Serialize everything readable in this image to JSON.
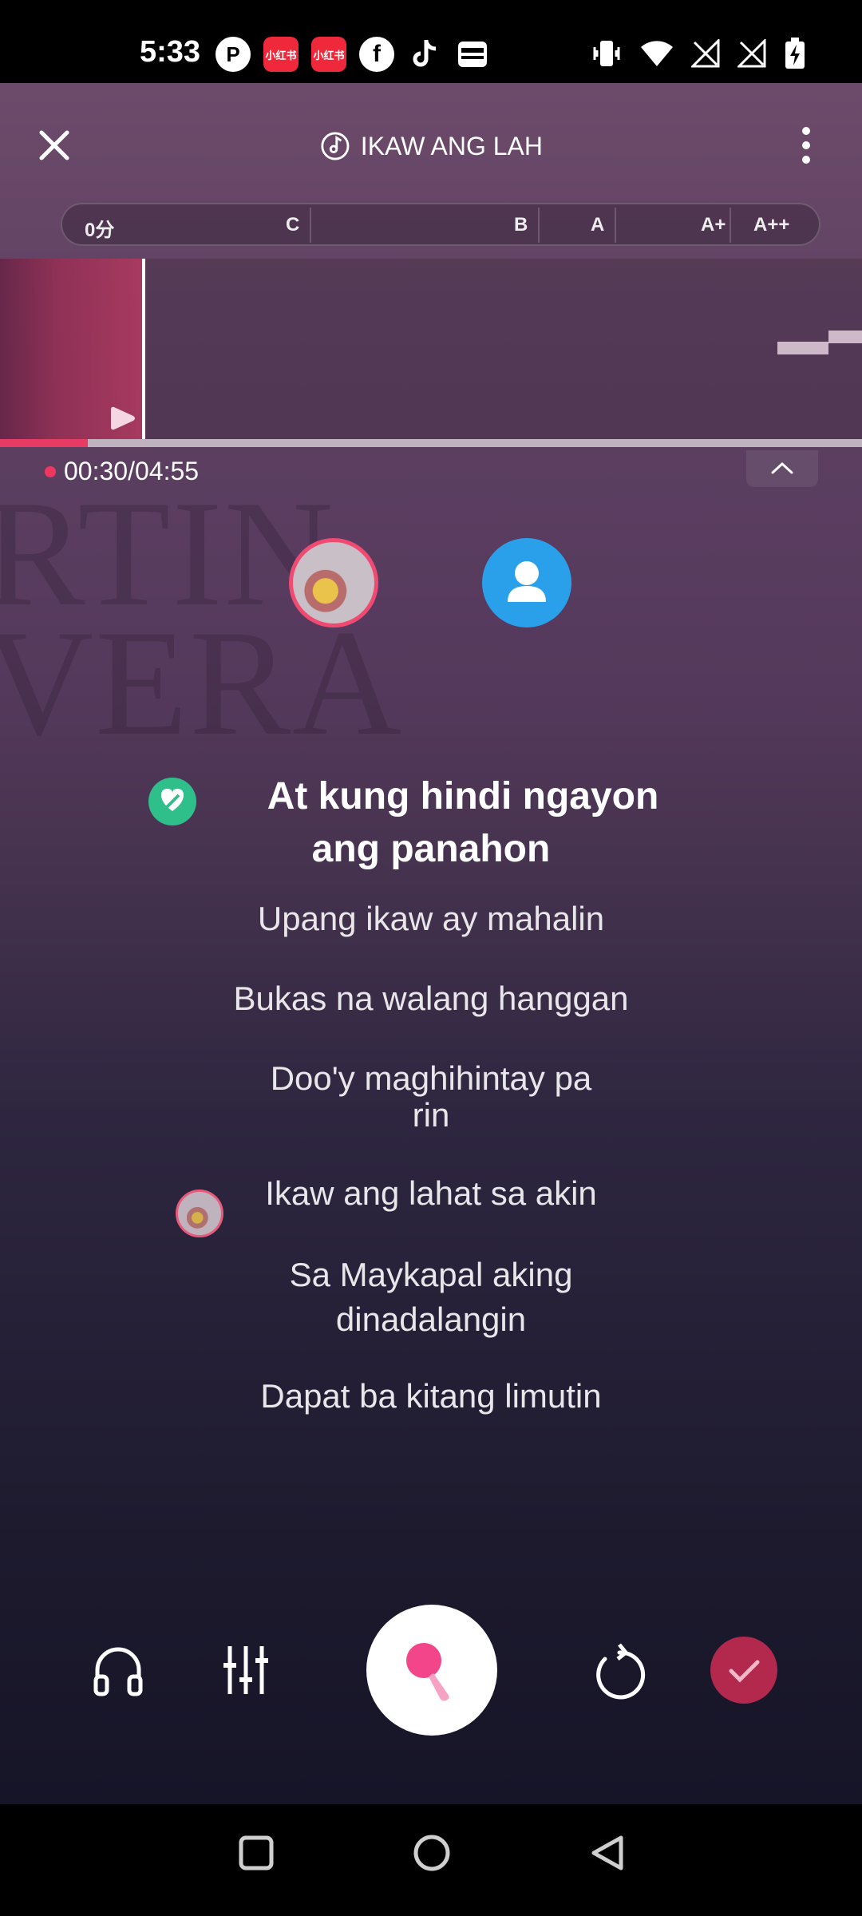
{
  "status_bar": {
    "time": "5:33",
    "app_icons": [
      "p-app-icon",
      "xiaohongshu-icon",
      "xiaohongshu-icon",
      "facebook-icon",
      "tiktok-icon",
      "wallet-icon"
    ],
    "xiaohongshu_label": "小红书",
    "right_icons": [
      "vibrate-icon",
      "wifi-icon",
      "no-signal-icon",
      "no-signal-icon",
      "battery-charging-icon"
    ]
  },
  "header": {
    "song_title": "IKAW ANG LAH"
  },
  "score_bar": {
    "score": "0分",
    "grades": [
      "C",
      "B",
      "A",
      "A+",
      "A++"
    ]
  },
  "playback": {
    "time": "00:30/04:55",
    "progress_fraction": 0.102
  },
  "lyrics": {
    "active_line1": "At kung hindi ngayon",
    "active_line2": "ang panahon",
    "line1": "Upang ikaw ay mahalin",
    "line2": "Bukas na walang hanggan",
    "line3a": "Doo'y maghihintay pa",
    "line3b": "rin",
    "line4": "Ikaw ang lahat sa akin",
    "line5a": "Sa Maykapal aking",
    "line5b": "dinadalangin",
    "line6": "Dapat ba kitang limutin"
  },
  "colors": {
    "accent": "#e83b64",
    "done_button": "#b3294d",
    "singer_badge": "#2fbf8a",
    "user_avatar": "#2aa0ea"
  }
}
